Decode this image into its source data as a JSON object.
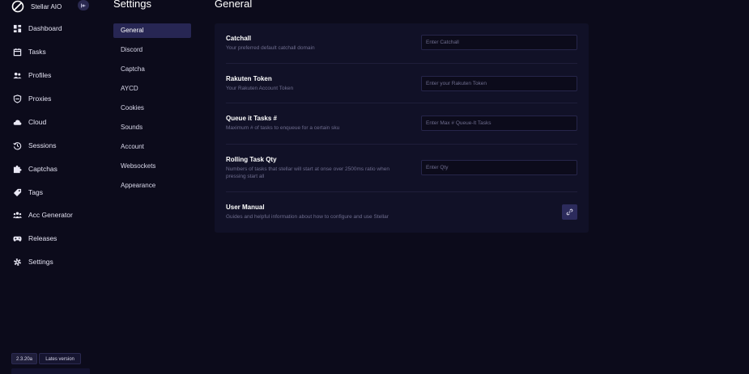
{
  "app": {
    "name": "Stellar AIO"
  },
  "sidebar": {
    "items": [
      {
        "label": "Dashboard",
        "icon": "dashboard-icon"
      },
      {
        "label": "Tasks",
        "icon": "calendar-icon"
      },
      {
        "label": "Profiles",
        "icon": "users-icon"
      },
      {
        "label": "Proxies",
        "icon": "shield-icon"
      },
      {
        "label": "Cloud",
        "icon": "cloud-icon"
      },
      {
        "label": "Sessions",
        "icon": "history-icon"
      },
      {
        "label": "Captchas",
        "icon": "puzzle-icon"
      },
      {
        "label": "Tags",
        "icon": "tag-icon"
      },
      {
        "label": "Acc Generator",
        "icon": "user-group-icon"
      },
      {
        "label": "Releases",
        "icon": "gamepad-icon"
      },
      {
        "label": "Settings",
        "icon": "gear-icon"
      }
    ],
    "version": "2.3.20a",
    "version_status": "Lates version"
  },
  "settings_menu": {
    "title": "Settings",
    "items": [
      "General",
      "Discord",
      "Captcha",
      "AYCD",
      "Cookies",
      "Sounds",
      "Account",
      "Websockets",
      "Appearance"
    ],
    "active": "General"
  },
  "general": {
    "title": "General",
    "rows": [
      {
        "title": "Catchall",
        "description": "Your preferred default catchall domain",
        "placeholder": "Enter Catchall"
      },
      {
        "title": "Rakuten Token",
        "description": "Your Rakuten Account Token",
        "placeholder": "Enter your Rakuten Token"
      },
      {
        "title": "Queue it Tasks #",
        "description": "Maximum # of tasks to enqueue for a certain sku",
        "placeholder": "Enter Max # Queue-It Tasks"
      },
      {
        "title": "Rolling Task Qty",
        "description": "Numbers of tasks that stellar will start at onse over 2500ms ratio when pressing start all",
        "placeholder": "Enter Qty"
      }
    ],
    "manual": {
      "title": "User Manual",
      "description": "Guides and helpful information about how to configure and use Stellar",
      "icon": "link-icon"
    }
  },
  "colors": {
    "background": "#0c0b1b",
    "panel": "#111127",
    "active": "#272653",
    "accent": "#2c2b5c"
  }
}
